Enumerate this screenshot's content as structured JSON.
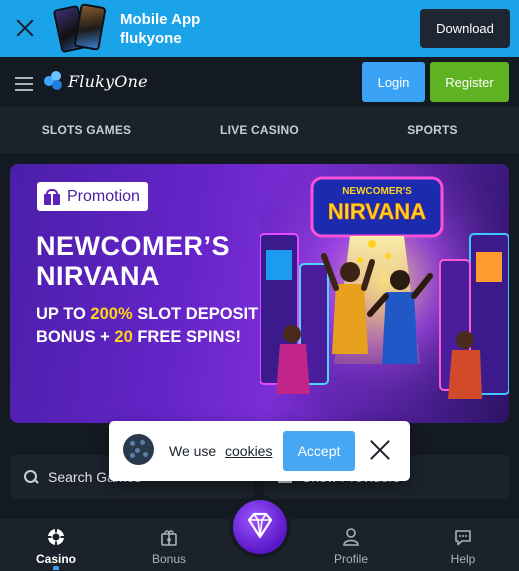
{
  "app_banner": {
    "title_line1": "Mobile App",
    "title_line2": "flukyone",
    "download_label": "Download"
  },
  "header": {
    "logo_text": "FlukyOne",
    "login_label": "Login",
    "register_label": "Register"
  },
  "nav": {
    "items": [
      {
        "label": "SLOTS GAMES"
      },
      {
        "label": "LIVE CASINO"
      },
      {
        "label": "SPORTS"
      }
    ]
  },
  "promo": {
    "badge": "Promotion",
    "art_sign_top": "NEWCOMER'S",
    "art_sign_main": "NIRVANA",
    "title_line1": "NEWCOMER’S",
    "title_line2": "NIRVANA",
    "sub_a": "UP TO ",
    "sub_b": "200%",
    "sub_c": " SLOT DEPOSIT",
    "sub_d": "BONUS + ",
    "sub_e": "20",
    "sub_f": " FREE SPINS!",
    "highlight_color": "#ffd21f"
  },
  "search": {
    "placeholder": "Search Games",
    "providers_label": "Show Providers"
  },
  "cookie": {
    "text": "We use",
    "link": "cookies",
    "accept_label": "Accept"
  },
  "bottom_nav": {
    "items": [
      {
        "label": "Casino",
        "icon": "casino-chip-icon",
        "active": true
      },
      {
        "label": "Bonus",
        "icon": "bonus-gift-icon"
      },
      {
        "label": "Profile",
        "icon": "profile-icon"
      },
      {
        "label": "Help",
        "icon": "chat-help-icon"
      }
    ],
    "center_icon": "diamond-icon"
  },
  "colors": {
    "banner_bg": "#1aa3e8",
    "login": "#3ba3f5",
    "register": "#5fb323",
    "promo_purple": "#6424c8",
    "page_bg": "#141a21"
  }
}
